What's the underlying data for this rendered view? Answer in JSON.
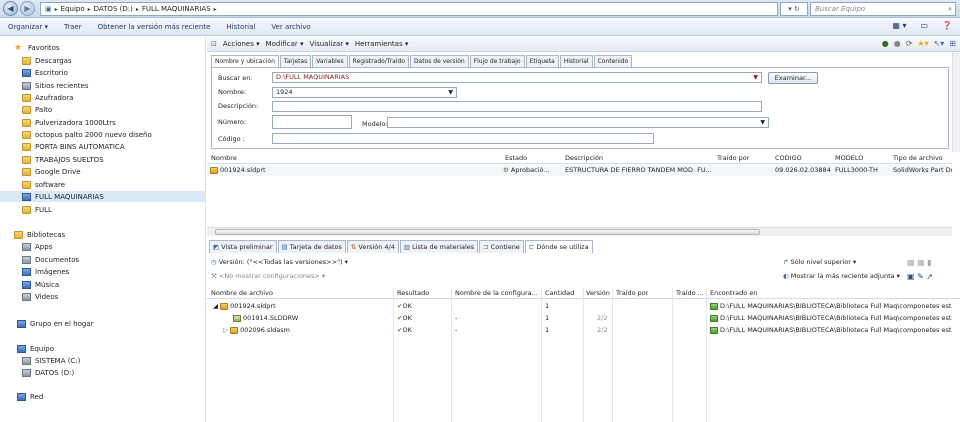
{
  "address": {
    "crumbs": [
      "Equipo",
      "DATOS (D:)",
      "FULL MAQUINARIAS"
    ],
    "search_placeholder": "Buscar Equipo"
  },
  "menu": [
    "Organizar ▾",
    "Traer",
    "Obtener la versión más reciente",
    "Historial",
    "Ver archivo"
  ],
  "nav": {
    "items": [
      {
        "label": "Favoritos",
        "icon": "star-icon"
      },
      {
        "label": "Descargas",
        "icon": "folder-icon"
      },
      {
        "label": "Escritorio",
        "icon": "desktop-icon"
      },
      {
        "label": "Sitios recientes",
        "icon": "recent-icon"
      },
      {
        "label": "Azufradora",
        "icon": "folder-icon"
      },
      {
        "label": "Palto",
        "icon": "folder-icon"
      },
      {
        "label": "Pulverizadora 1000Ltrs",
        "icon": "folder-icon"
      },
      {
        "label": "octopus palto 2000 nuevo diseño",
        "icon": "folder-icon"
      },
      {
        "label": "PORTA BINS AUTOMATICA",
        "icon": "folder-icon"
      },
      {
        "label": "TRABAJOS SUELTOS",
        "icon": "folder-icon"
      },
      {
        "label": "Google Drive",
        "icon": "folder-icon"
      },
      {
        "label": "software",
        "icon": "folder-icon"
      },
      {
        "label": "FULL MAQUINARIAS",
        "icon": "vault-icon"
      },
      {
        "label": "FULL",
        "icon": "folder-icon"
      },
      {
        "label": "Bibliotecas",
        "icon": "library-icon"
      },
      {
        "label": "Apps",
        "icon": "apps-icon"
      },
      {
        "label": "Documentos",
        "icon": "documents-icon"
      },
      {
        "label": "Imágenes",
        "icon": "images-icon"
      },
      {
        "label": "Música",
        "icon": "music-icon"
      },
      {
        "label": "Videos",
        "icon": "videos-icon"
      },
      {
        "label": "Grupo en el hogar",
        "icon": "homegroup-icon"
      },
      {
        "label": "Equipo",
        "icon": "computer-icon"
      },
      {
        "label": "SISTEMA (C:)",
        "icon": "drive-icon"
      },
      {
        "label": "DATOS (D:)",
        "icon": "drive-icon"
      },
      {
        "label": "Red",
        "icon": "network-icon"
      }
    ]
  },
  "pdm_toolbar": [
    "Acciones ▾",
    "Modificar ▾",
    "Visualizar ▾",
    "Herramientas ▾"
  ],
  "upper_tabs": [
    "Nombre y ubicación",
    "Tarjetas",
    "Variables",
    "Registrado/Traído",
    "Datos de versión",
    "Flujo de trabajo",
    "Etiqueta",
    "Historial",
    "Contenido"
  ],
  "search_form": {
    "buscar_en_label": "Buscar en:",
    "buscar_en_value": "D:\\FULL MAQUINARIAS",
    "examinar": "Examinar...",
    "nombre_label": "Nombre:",
    "nombre_value": "1924",
    "descripcion_label": "Descripción:",
    "numero_label": "Número:",
    "modelo_label": "Modelo:",
    "codigo_label": "Código :"
  },
  "result_grid": {
    "headers": [
      "Nombre",
      "Estado",
      "Descripción",
      "Traído por",
      "CODIGO",
      "MODELO",
      "Tipo de archivo"
    ],
    "row": [
      "001924.sldprt",
      "Aprobació...",
      "ESTRUCTURA DE FIERRO TANDEM MOD. FU...",
      "",
      "09.026.02.03884",
      "FULL3000-TH",
      "SolidWorks Part Doc"
    ]
  },
  "lower_tabs": [
    "Vista preliminar",
    "Tarjeta de datos",
    "Versión 4/4",
    "Lista de materiales",
    "Contiene",
    "Dónde se utiliza"
  ],
  "lower_toolbar": {
    "version_label": "Versión:",
    "version_value": "(\"<<Todas las versiones>>\") ▾",
    "no_config": "<No mostrar configuraciones> ▾",
    "solo_nivel": "Sólo nivel superior ▾",
    "mostrar_reciente": "Mostrar la más reciente adjunta ▾"
  },
  "where_used": {
    "headers": [
      "Nombre de archivo",
      "Resultado",
      "Nombre de la configura...",
      "Cantidad",
      "Versión",
      "Traído por",
      "Traído ...",
      "Encontrado en"
    ],
    "rows": [
      {
        "name": "001924.sldprt",
        "result": "OK",
        "config": "",
        "qty": "1",
        "version": "",
        "path": "D:\\FULL MAQUINARIAS\\BIBLIOTECA\\Biblioteca Full Maq\\componetes est",
        "icon": "part-icon",
        "indent": 1
      },
      {
        "name": "001914.SLDDRW",
        "result": "OK",
        "config": "-",
        "qty": "1",
        "version": "2/2",
        "path": "D:\\FULL MAQUINARIAS\\BIBLIOTECA\\Biblioteca Full Maq\\componetes est",
        "icon": "drawing-icon",
        "indent": 2
      },
      {
        "name": "002096.sldasm",
        "result": "OK",
        "config": "-",
        "qty": "1",
        "version": "2/2",
        "path": "D:\\FULL MAQUINARIAS\\BIBLIOTECA\\Biblioteca Full Maq\\componetes est",
        "icon": "assembly-icon",
        "indent": 2
      }
    ]
  }
}
